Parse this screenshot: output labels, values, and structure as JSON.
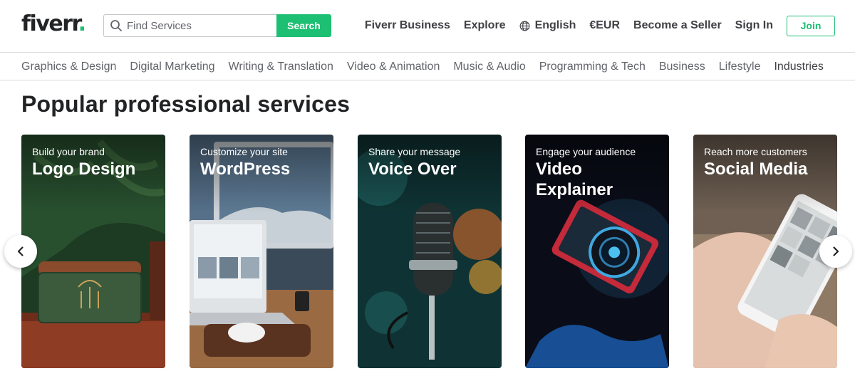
{
  "header": {
    "logo": {
      "text": "fiverr",
      "dot": "."
    },
    "search": {
      "placeholder": "Find Services",
      "button_label": "Search"
    },
    "nav": {
      "business": "Fiverr Business",
      "explore": "Explore",
      "language": "English",
      "currency": "€EUR",
      "become_seller": "Become a Seller",
      "sign_in": "Sign In",
      "join": "Join"
    }
  },
  "categories": [
    "Graphics & Design",
    "Digital Marketing",
    "Writing & Translation",
    "Video & Animation",
    "Music & Audio",
    "Programming & Tech",
    "Business",
    "Lifestyle",
    "Industries"
  ],
  "section": {
    "title": "Popular professional services",
    "cards": [
      {
        "subtitle": "Build your brand",
        "title": "Logo Design"
      },
      {
        "subtitle": "Customize your site",
        "title": "WordPress"
      },
      {
        "subtitle": "Share your message",
        "title": "Voice Over"
      },
      {
        "subtitle": "Engage your audience",
        "title": "Video Explainer"
      },
      {
        "subtitle": "Reach more customers",
        "title": "Social Media"
      }
    ]
  },
  "colors": {
    "brand_green": "#1dbf73",
    "text_dark": "#222325",
    "text_muted": "#62646a"
  },
  "icons": {
    "search": "search-icon",
    "language": "globe-icon",
    "prev": "chevron-left-icon",
    "next": "chevron-right-icon"
  }
}
